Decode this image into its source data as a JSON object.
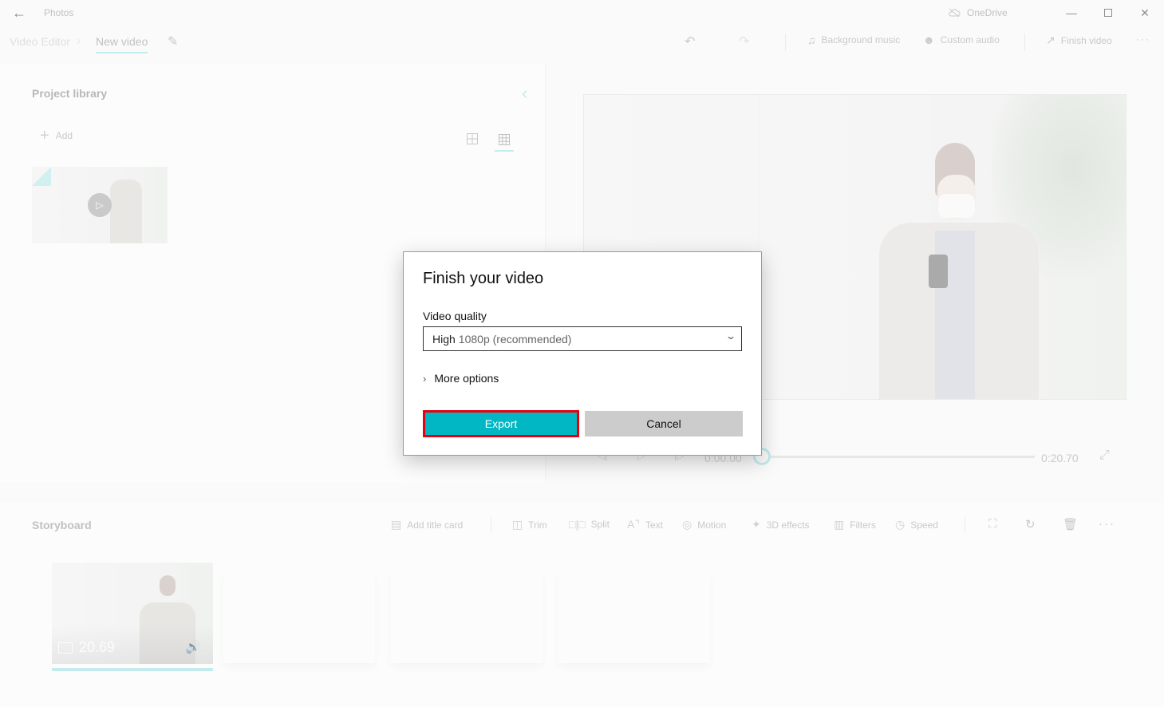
{
  "titlebar": {
    "app_title": "Photos",
    "onedrive_label": "OneDrive"
  },
  "breadcrumb": {
    "root": "Video Editor",
    "current": "New video"
  },
  "toolbar": {
    "background_music": "Background music",
    "custom_audio": "Custom audio",
    "finish_video": "Finish video"
  },
  "library": {
    "title": "Project library",
    "add_label": "Add"
  },
  "player": {
    "current_time": "0:00.00",
    "total_time": "0:20.70",
    "progress_fraction": 0
  },
  "storyboard": {
    "title": "Storyboard",
    "tools": [
      {
        "label": "Add title card",
        "icon": "title-card-icon"
      },
      {
        "label": "Trim",
        "icon": "trim-icon"
      },
      {
        "label": "Split",
        "icon": "split-icon"
      },
      {
        "label": "Text",
        "icon": "text-icon"
      },
      {
        "label": "Motion",
        "icon": "motion-icon"
      },
      {
        "label": "3D effects",
        "icon": "3d-effects-icon"
      },
      {
        "label": "Filters",
        "icon": "filters-icon"
      },
      {
        "label": "Speed",
        "icon": "speed-icon"
      }
    ],
    "clips": [
      {
        "duration": "20.69"
      }
    ]
  },
  "dialog": {
    "title": "Finish your video",
    "quality_label": "Video quality",
    "quality_main": "High",
    "quality_sub": "1080p (recommended)",
    "more_options": "More options",
    "export_label": "Export",
    "cancel_label": "Cancel"
  },
  "colors": {
    "accent": "#00b7c3",
    "accent_light": "#8fdde3",
    "highlight_border": "#e8000f"
  }
}
